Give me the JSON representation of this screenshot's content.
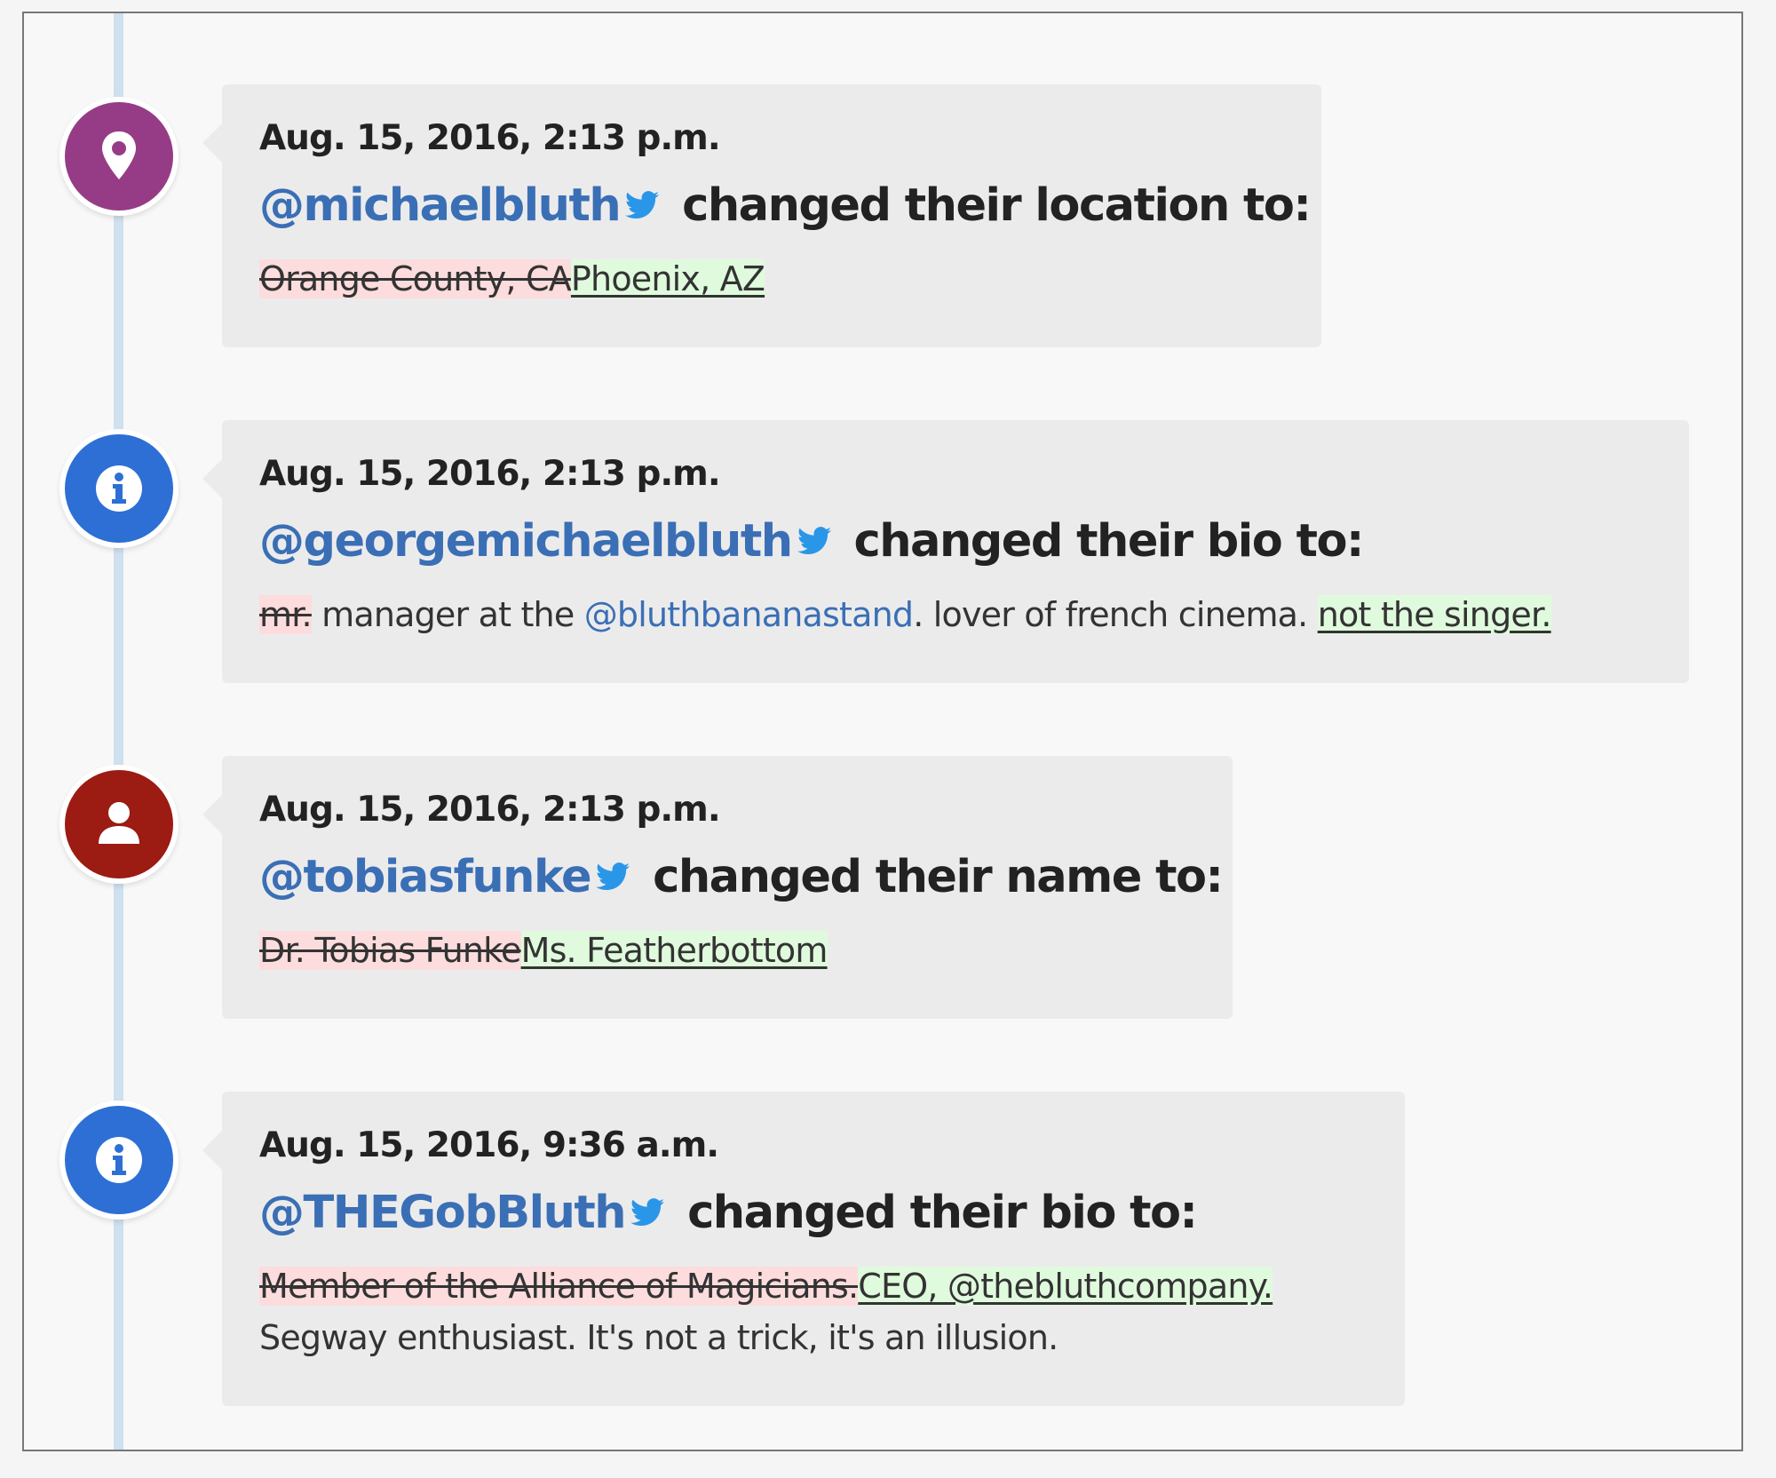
{
  "colors": {
    "location_icon": "#963c87",
    "info_icon": "#2d6fd4",
    "name_icon": "#9c1b13",
    "handle": "#3a6fb5",
    "deleted_bg": "#fcdcdd",
    "inserted_bg": "#e0fadd",
    "timeline": "#cfe0ee",
    "card_bg": "#ecebec"
  },
  "entries": [
    {
      "icon": "location-pin-icon",
      "timestamp": "Aug. 15, 2016, 2:13 p.m.",
      "handle": "@michaelbluth",
      "action": "changed their location to:",
      "deleted": "Orange County, CA",
      "inserted": "Phoenix, AZ"
    },
    {
      "icon": "info-icon",
      "timestamp": "Aug. 15, 2016, 2:13 p.m.",
      "handle": "@georgemichaelbluth",
      "action": "changed their bio to:",
      "deleted": "mr.",
      "text_before_mention": " manager at the ",
      "mention": "@bluthbananastand",
      "text_after_mention": ". lover of french cinema. ",
      "inserted": "not the singer."
    },
    {
      "icon": "person-icon",
      "timestamp": "Aug. 15, 2016, 2:13 p.m.",
      "handle": "@tobiasfunke",
      "action": "changed their name to:",
      "deleted": "Dr. Tobias Funke",
      "inserted": "Ms. Featherbottom"
    },
    {
      "icon": "info-icon",
      "timestamp": "Aug. 15, 2016, 9:36 a.m.",
      "handle": "@THEGobBluth",
      "action": "changed their bio to:",
      "deleted": "Member of the Alliance of Magicians.",
      "inserted": "CEO, @thebluthcompany.",
      "trailing_text": "Segway enthusiast. It's not a trick, it's an illusion."
    }
  ]
}
